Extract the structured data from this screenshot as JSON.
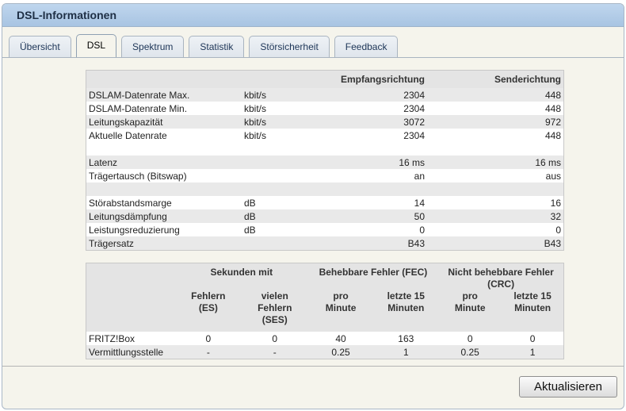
{
  "window": {
    "title": "DSL-Informationen"
  },
  "tabs": [
    {
      "label": "Übersicht",
      "active": false
    },
    {
      "label": "DSL",
      "active": true
    },
    {
      "label": "Spektrum",
      "active": false
    },
    {
      "label": "Statistik",
      "active": false
    },
    {
      "label": "Störsicherheit",
      "active": false
    },
    {
      "label": "Feedback",
      "active": false
    }
  ],
  "dsl_table": {
    "headers": {
      "down": "Empfangsrichtung",
      "up": "Senderichtung"
    },
    "rows": [
      {
        "label": "DSLAM-Datenrate Max.",
        "unit": "kbit/s",
        "down": "2304",
        "up": "448"
      },
      {
        "label": "DSLAM-Datenrate Min.",
        "unit": "kbit/s",
        "down": "2304",
        "up": "448"
      },
      {
        "label": "Leitungskapazität",
        "unit": "kbit/s",
        "down": "3072",
        "up": "972"
      },
      {
        "label": "Aktuelle Datenrate",
        "unit": "kbit/s",
        "down": "2304",
        "up": "448"
      },
      {
        "label": "Latenz",
        "unit": "",
        "down": "16 ms",
        "up": "16 ms"
      },
      {
        "label": "Trägertausch (Bitswap)",
        "unit": "",
        "down": "an",
        "up": "aus"
      },
      {
        "label": "Störabstandsmarge",
        "unit": "dB",
        "down": "14",
        "up": "16"
      },
      {
        "label": "Leitungsdämpfung",
        "unit": "dB",
        "down": "50",
        "up": "32"
      },
      {
        "label": "Leistungsreduzierung",
        "unit": "dB",
        "down": "0",
        "up": "0"
      },
      {
        "label": "Trägersatz",
        "unit": "",
        "down": "B43",
        "up": "B43"
      }
    ]
  },
  "error_table": {
    "group_headers": {
      "seconds": "Sekunden mit",
      "fec": "Behebbare Fehler (FEC)",
      "crc": "Nicht behebbare Fehler (CRC)"
    },
    "sub_headers": {
      "es": "Fehlern (ES)",
      "ses": "vielen Fehlern (SES)",
      "fec_min": "pro Minute",
      "fec_15": "letzte 15 Minuten",
      "crc_min": "pro Minute",
      "crc_15": "letzte 15 Minuten"
    },
    "rows": [
      {
        "label": "FRITZ!Box",
        "es": "0",
        "ses": "0",
        "fec_min": "40",
        "fec_15": "163",
        "crc_min": "0",
        "crc_15": "0"
      },
      {
        "label": "Vermittlungsstelle",
        "es": "-",
        "ses": "-",
        "fec_min": "0.25",
        "fec_15": "1",
        "crc_min": "0.25",
        "crc_15": "1"
      }
    ]
  },
  "actions": {
    "refresh_label": "Aktualisieren"
  }
}
